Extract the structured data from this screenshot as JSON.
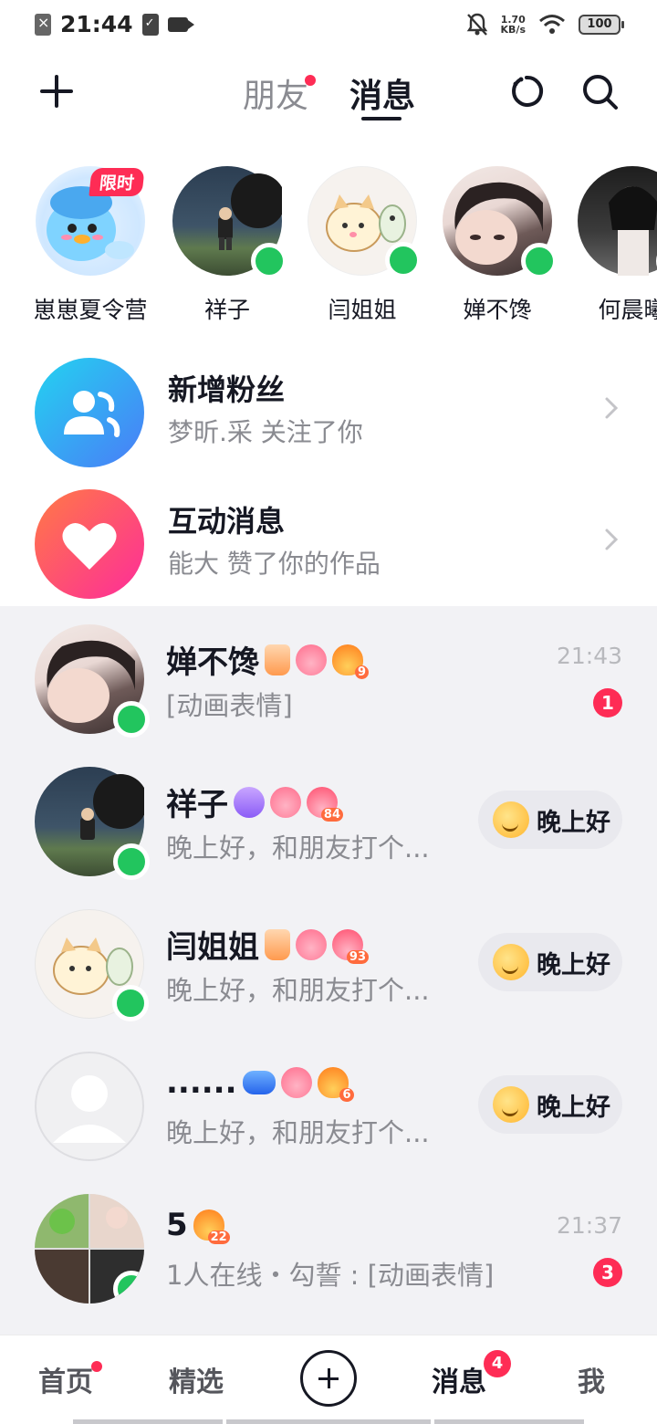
{
  "status_bar": {
    "time": "21:44",
    "speed_value": "1.70",
    "speed_unit": "KB/s",
    "battery": "100"
  },
  "header": {
    "tabs": [
      {
        "label": "朋友",
        "active": false,
        "has_dot": true
      },
      {
        "label": "消息",
        "active": true,
        "has_dot": false
      }
    ]
  },
  "stories": [
    {
      "name": "崽崽夏令营",
      "tag": "限时",
      "online": false
    },
    {
      "name": "祥子",
      "online": true
    },
    {
      "name": "闫姐姐",
      "online": true
    },
    {
      "name": "婵不馋",
      "online": true
    },
    {
      "name": "何晨曦",
      "online": true
    }
  ],
  "notifications": [
    {
      "title": "新增粉丝",
      "subtitle": "梦昕.采 关注了你",
      "color_from": "#23d3f0",
      "color_to": "#4a7cf7"
    },
    {
      "title": "互动消息",
      "subtitle": "能大 赞了你的作品",
      "color_from": "#ff7a45",
      "color_to": "#fe2c9a"
    }
  ],
  "chats": [
    {
      "name": "婵不馋",
      "preview": "[动画表情]",
      "time": "21:43",
      "unread": "1",
      "badge_numbers": [
        "9"
      ],
      "online": true
    },
    {
      "name": "祥子",
      "preview": "晚上好，和朋友打个...",
      "action": "晚上好",
      "badge_numbers": [
        "84"
      ],
      "online": true
    },
    {
      "name": "闫姐姐",
      "preview": "晚上好，和朋友打个...",
      "action": "晚上好",
      "badge_numbers": [
        "93"
      ],
      "online": true
    },
    {
      "name": "......",
      "preview": "晚上好，和朋友打个...",
      "action": "晚上好",
      "badge_numbers": [
        "6"
      ],
      "online": false
    },
    {
      "name": "5",
      "preview": "1人在线・勾誓 : [动画表情]",
      "time": "21:37",
      "unread": "3",
      "badge_numbers": [
        "22"
      ],
      "online": true
    }
  ],
  "bottom_nav": {
    "home": "首页",
    "featured": "精选",
    "messages": "消息",
    "messages_count": "4",
    "me": "我"
  },
  "colors": {
    "accent": "#fe2c55",
    "online": "#22c55e",
    "list_bg": "#f2f2f5"
  }
}
